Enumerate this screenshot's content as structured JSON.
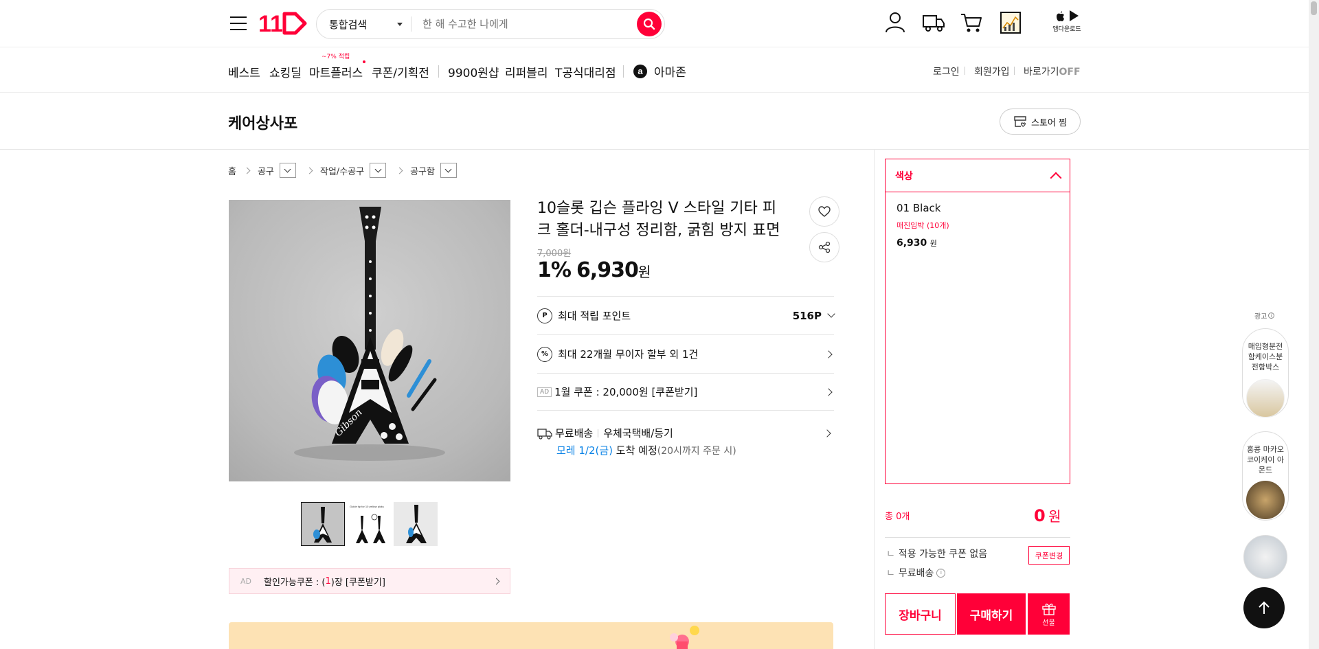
{
  "header": {
    "search_category": "통합검색",
    "search_placeholder": "한 해 수고한 나에게",
    "app_download": "앱다운로드"
  },
  "nav": {
    "items": [
      "베스트",
      "쇼킹딜",
      "마트플러스",
      "쿠폰/기획전",
      "9900원샵",
      "리퍼블리",
      "T공식대리점",
      "아마존"
    ],
    "mart_badge": "~7% 적립",
    "login": "로그인",
    "signup": "회원가입",
    "shortcut": "바로가기",
    "shortcut_state": "OFF"
  },
  "store": {
    "name": "케어상사포",
    "follow_label": "스토어 찜"
  },
  "breadcrumb": [
    "홈",
    "공구",
    "작업/수공구",
    "공구함"
  ],
  "product": {
    "title_line1": "10슬롯 깁슨 플라잉 V 스타일 기타 피",
    "title_line2": "크 홀더-내구성 정리함, 굵힘 방지 표면",
    "original_price": "7,000원",
    "discount": "1%",
    "price": "6,930",
    "price_unit": "원",
    "points_label": "최대 적립 포인트",
    "points_value": "516P",
    "installment": "최대 22개월 무이자 할부 외 1건",
    "coupon_ad_tag": "AD",
    "coupon_text": "1월 쿠폰 : 20,000원 [쿠폰받기]",
    "shipping_free": "무료배송",
    "shipping_method": "우체국택배/등기",
    "arrival_date": "모레 1/2(금)",
    "arrival_text": "도착 예정",
    "arrival_note": "(20시까지 주문 시)",
    "discount_coupon_tag": "AD",
    "discount_coupon_prefix": "할인가능쿠폰 : (",
    "discount_coupon_count": "1",
    "discount_coupon_suffix": ")장 [쿠폰받기]",
    "guitar_brand": "Gibson",
    "thumb2_caption": "Guide tip for 10 yellow picks"
  },
  "option_panel": {
    "header": "색상",
    "option_name": "01 Black",
    "option_stock": "매진임박 (10개)",
    "option_price": "6,930",
    "option_price_unit": "원",
    "total_label": "총 0개",
    "total_value": "0",
    "total_unit": "원",
    "no_coupon": "적용 가능한 쿠폰 없음",
    "coupon_change": "쿠폰변경",
    "free_shipping": "무료배송",
    "cart_button": "장바구니",
    "buy_button": "구매하기",
    "gift_button": "선물"
  },
  "side_ads": {
    "ad_label": "광고",
    "item1": "매입형분전함케이스분전함박스",
    "item2": "홍콩 마카오 코이케이 아몬드"
  },
  "colors": {
    "accent": "#ff0038",
    "blue": "#0b83e6"
  }
}
